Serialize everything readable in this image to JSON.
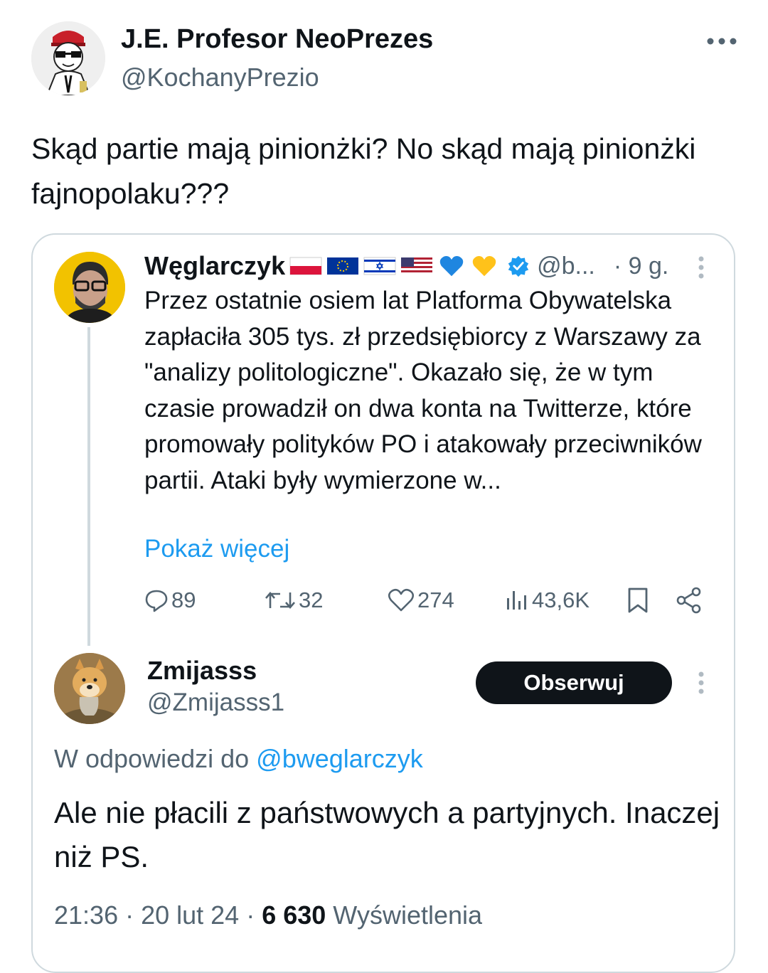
{
  "post": {
    "author_name": "J.E. Profesor NeoPrezes",
    "author_handle": "@KochanyPrezio",
    "text": "Skąd partie mają pinionżki? No skąd mają pinionżki fajnopolaku???"
  },
  "quoted": {
    "author_name": "Węglarczyk",
    "name_emojis": [
      "flag-poland-icon",
      "flag-eu-icon",
      "flag-israel-icon",
      "flag-usa-icon",
      "blue-heart-icon",
      "yellow-heart-icon"
    ],
    "verified": true,
    "handle": "@b...",
    "time": "· 9 g.",
    "text": "Przez ostatnie osiem lat Platforma Obywatelska zapłaciła 305 tys. zł przedsiębiorcy z Warszawy za \"analizy politologiczne\". Okazało się, że w tym czasie prowadził on dwa konta na Twitterze, które promowały polityków PO i atakowały przeciwników partii. Ataki były wymierzone w...",
    "show_more": "Pokaż więcej",
    "stats": {
      "replies": "89",
      "retweets": "32",
      "likes": "274",
      "views": "43,6K"
    }
  },
  "reply": {
    "author_name": "Zmijasss",
    "handle": "@Zmijasss1",
    "follow_label": "Obserwuj",
    "reply_to_prefix": "W odpowiedzi do",
    "reply_to_mention": "@bweglarczyk",
    "text": "Ale nie płacili z państwowych a partyjnych. Inaczej niż PS.",
    "time": "21:36 · 20 lut 24 · ",
    "views_count": "6 630",
    "views_label": "Wyświetlenia"
  },
  "colors": {
    "text": "#0f1419",
    "secondary": "#536471",
    "link": "#1d9bf0",
    "border": "#cfd9de",
    "button": "#0f1419"
  }
}
